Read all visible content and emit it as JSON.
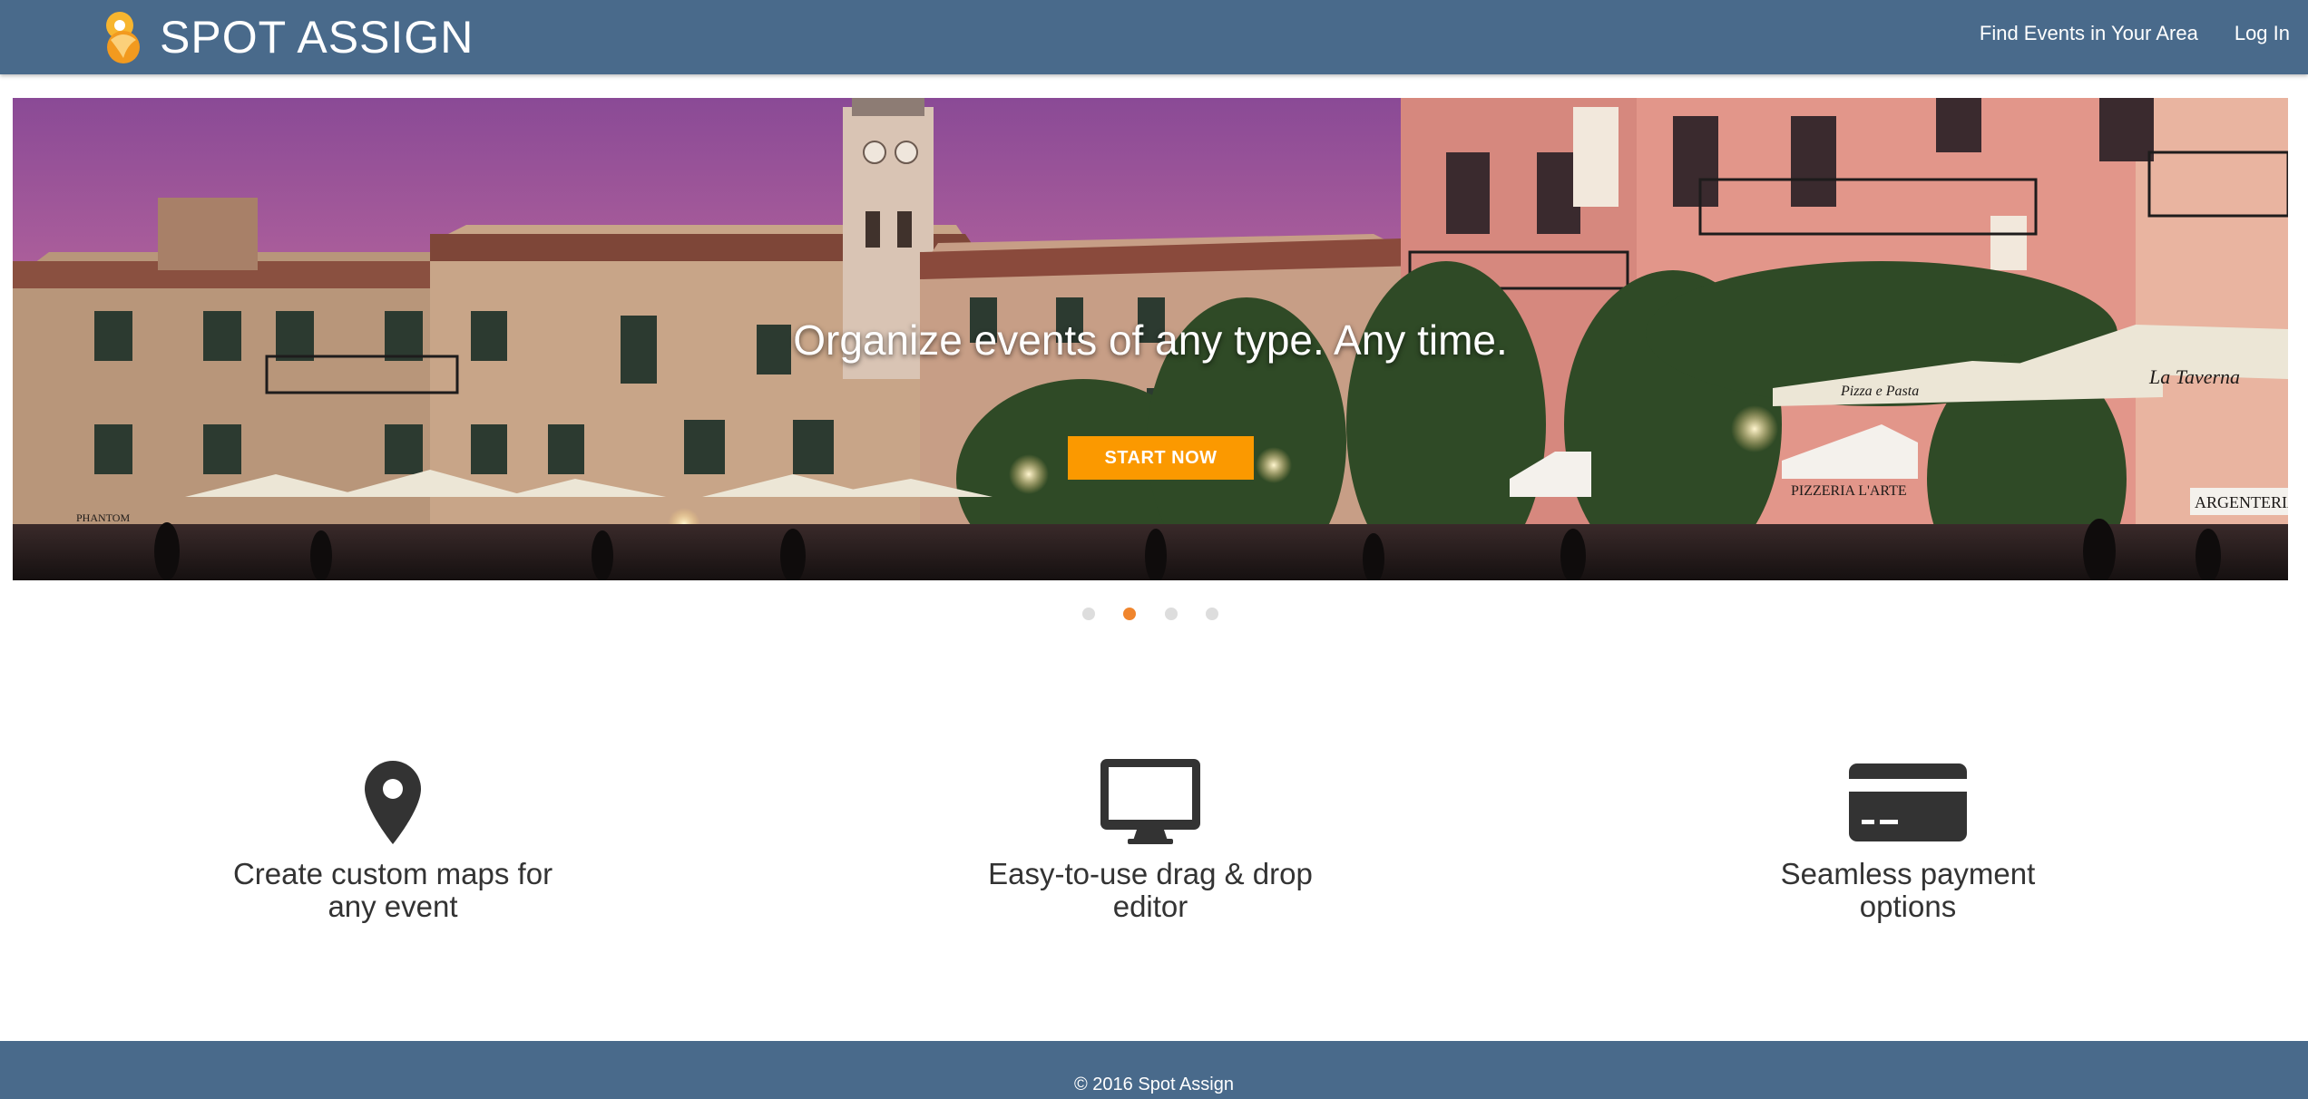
{
  "header": {
    "brand_name": "SPOT ASSIGN",
    "logo_icon": "spot-assign-logo",
    "nav": [
      {
        "label": "Find Events in Your Area"
      },
      {
        "label": "Log In"
      }
    ]
  },
  "hero": {
    "headline": "Organize events of any type. Any time.",
    "cta_label": "START NOW",
    "signs": [
      "PHANTOM",
      "Pizza e Pasta",
      "La Taverna",
      "PIZZERIA L'ARTE",
      "ARGENTERIA"
    ],
    "carousel": {
      "slide_count": 4,
      "active_index": 1
    }
  },
  "features": [
    {
      "icon": "map-marker-icon",
      "line1": "Create custom maps for",
      "line2": "any event"
    },
    {
      "icon": "desktop-monitor-icon",
      "line1": "Easy-to-use drag & drop",
      "line2": "editor"
    },
    {
      "icon": "credit-card-icon",
      "line1": "Seamless payment",
      "line2": "options"
    }
  ],
  "footer": {
    "text": "© 2016 Spot Assign"
  },
  "colors": {
    "navbar": "#496a8b",
    "accent": "#fb9900",
    "active_dot": "#f0852d",
    "inactive_dot": "#dddddd",
    "icon": "#333333"
  }
}
